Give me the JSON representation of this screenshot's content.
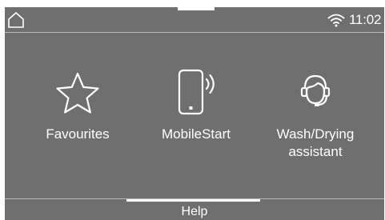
{
  "status_bar": {
    "home_icon": "home-icon",
    "wifi_icon": "wifi-icon",
    "time": "11:02"
  },
  "tiles": [
    {
      "label": "Favourites",
      "icon": "star-icon"
    },
    {
      "label": "MobileStart",
      "icon": "mobile-phone-signal-icon"
    },
    {
      "label": "Wash/Drying assistant",
      "icon": "assistant-headset-icon"
    }
  ],
  "footer": {
    "help_label": "Help"
  },
  "colors": {
    "background": "#6f6f6f",
    "foreground": "#ffffff",
    "divider": "#b7b7b7"
  }
}
